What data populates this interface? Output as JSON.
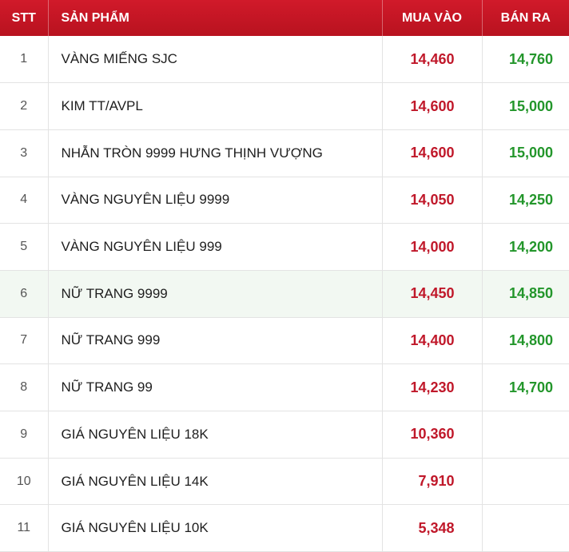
{
  "colors": {
    "header_bg": "#c8182a",
    "header_text": "#ffffff",
    "buy_price": "#c0182a",
    "sell_price": "#23962b",
    "highlight_row_bg": "#f2f8f2"
  },
  "table": {
    "headers": {
      "stt": "STT",
      "product": "SẢN PHẨM",
      "buy": "MUA VÀO",
      "sell": "BÁN RA"
    },
    "rows": [
      {
        "stt": "1",
        "product": "VÀNG MIẾNG SJC",
        "buy": "14,460",
        "sell": "14,760"
      },
      {
        "stt": "2",
        "product": "KIM TT/AVPL",
        "buy": "14,600",
        "sell": "15,000"
      },
      {
        "stt": "3",
        "product": "NHẪN TRÒN 9999 HƯNG THỊNH VƯỢNG",
        "buy": "14,600",
        "sell": "15,000"
      },
      {
        "stt": "4",
        "product": "VÀNG NGUYÊN LIỆU 9999",
        "buy": "14,050",
        "sell": "14,250"
      },
      {
        "stt": "5",
        "product": "VÀNG NGUYÊN LIỆU 999",
        "buy": "14,000",
        "sell": "14,200"
      },
      {
        "stt": "6",
        "product": "NỮ TRANG 9999",
        "buy": "14,450",
        "sell": "14,850"
      },
      {
        "stt": "7",
        "product": "NỮ TRANG 999",
        "buy": "14,400",
        "sell": "14,800"
      },
      {
        "stt": "8",
        "product": "NỮ TRANG 99",
        "buy": "14,230",
        "sell": "14,700"
      },
      {
        "stt": "9",
        "product": "GIÁ NGUYÊN LIỆU 18K",
        "buy": "10,360",
        "sell": ""
      },
      {
        "stt": "10",
        "product": "GIÁ NGUYÊN LIỆU 14K",
        "buy": "7,910",
        "sell": ""
      },
      {
        "stt": "11",
        "product": "GIÁ NGUYÊN LIỆU 10K",
        "buy": "5,348",
        "sell": ""
      }
    ]
  }
}
